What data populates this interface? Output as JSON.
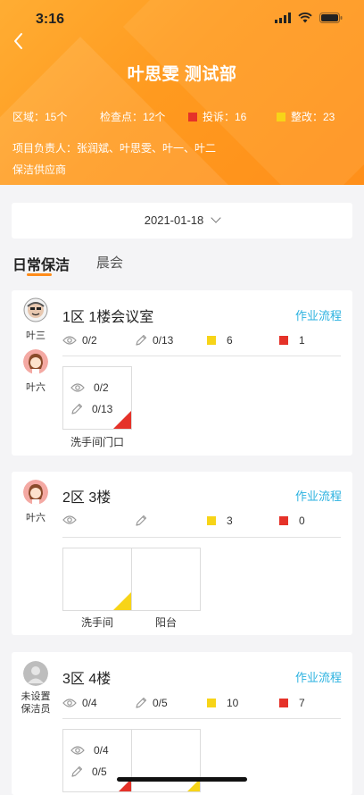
{
  "status_bar": {
    "time": "3:16"
  },
  "header": {
    "title": "叶思雯 测试部",
    "stats": {
      "area": "区域：15个",
      "checkpoints": "检查点：12个",
      "complaints": "投诉：16",
      "rectify": "整改：23"
    },
    "managers": "项目负责人：张润斌、叶思雯、叶一、叶二",
    "supplier": "保洁供应商"
  },
  "date_picker": {
    "value": "2021-01-18"
  },
  "tabs": [
    {
      "label": "日常保洁"
    },
    {
      "label": "晨会"
    }
  ],
  "colors": {
    "accent": "#ff8c1a",
    "link": "#2bb2e0",
    "red": "#e53229",
    "yellow": "#f7d418"
  },
  "cards": [
    {
      "title": "1区  1楼会议室",
      "workflow": "作业流程",
      "people": [
        "叶三",
        "叶六"
      ],
      "views": "0/2",
      "edits": "0/13",
      "yellow": "6",
      "red": "1",
      "tiles": [
        {
          "label": "洗手间门口",
          "views": "0/2",
          "edits": "0/13",
          "corner": "red"
        }
      ]
    },
    {
      "title": "2区  3楼",
      "workflow": "作业流程",
      "people": [
        "叶六"
      ],
      "views": "",
      "edits": "",
      "yellow": "3",
      "red": "0",
      "tiles": [
        {
          "label": "洗手间",
          "corner": "yellow"
        },
        {
          "label": "阳台",
          "corner": ""
        }
      ]
    },
    {
      "title": "3区  4楼",
      "workflow": "作业流程",
      "people": [
        "未设置保洁员"
      ],
      "views": "0/4",
      "edits": "0/5",
      "yellow": "10",
      "red": "7",
      "tiles": [
        {
          "views": "0/4",
          "edits": "0/5",
          "corner": "red"
        },
        {
          "corner": "yellow"
        }
      ]
    }
  ]
}
